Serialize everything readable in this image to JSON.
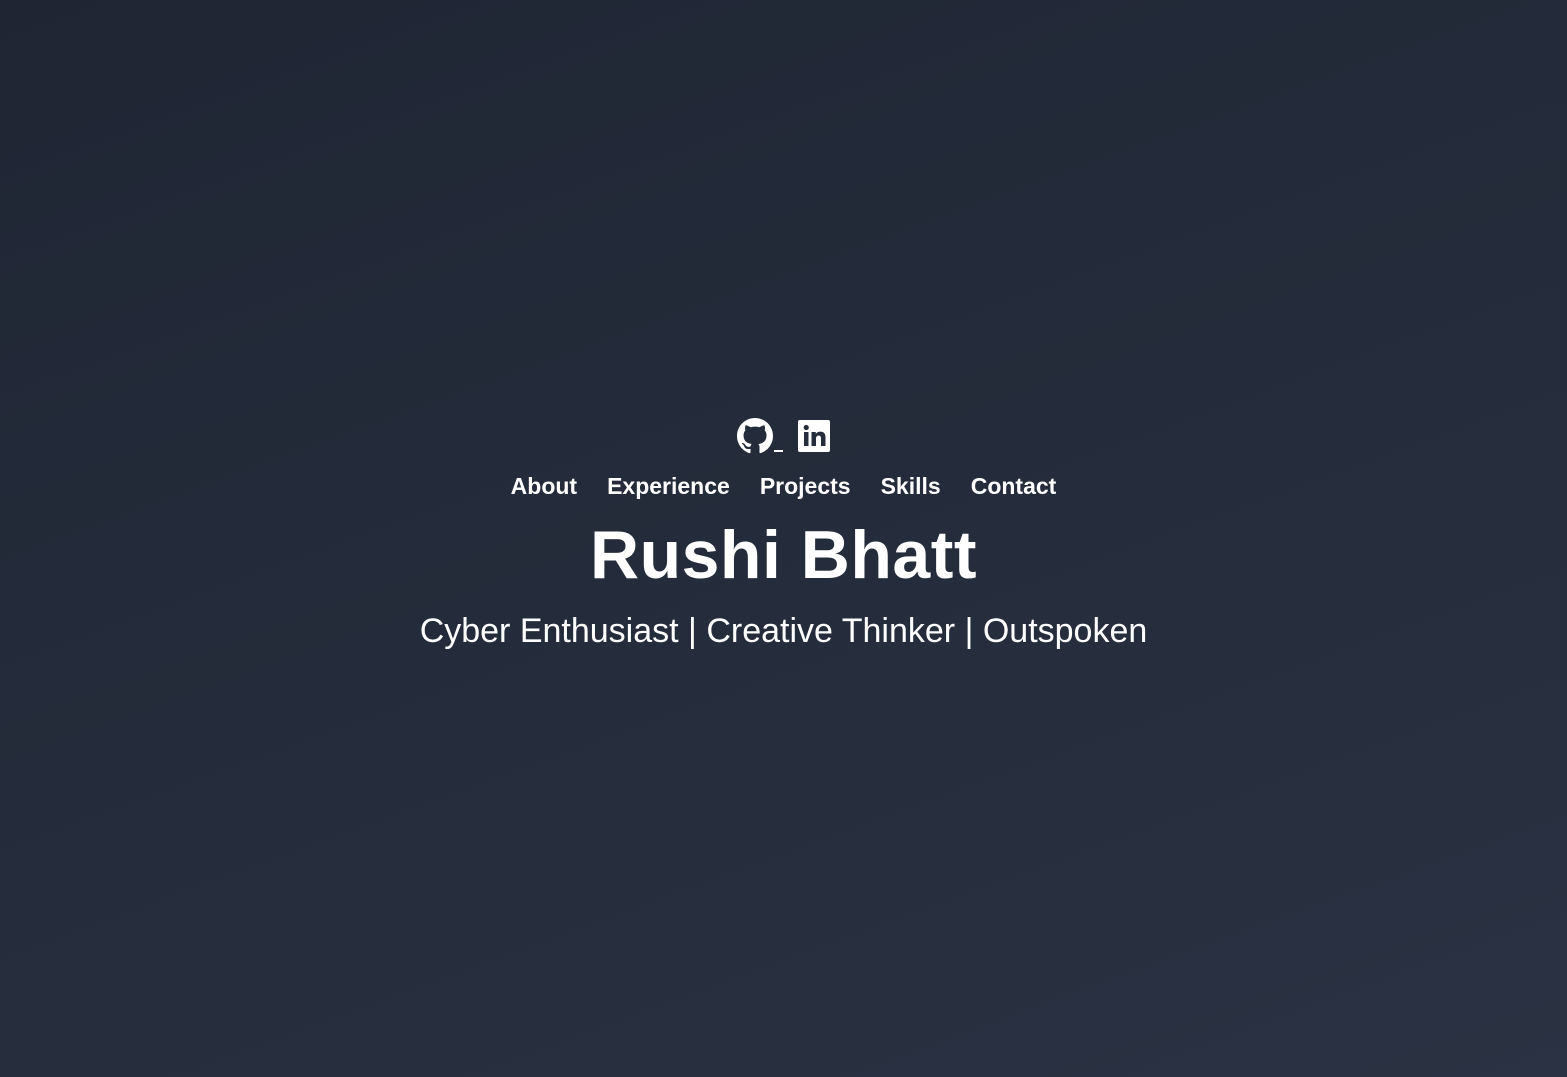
{
  "social": {
    "github_icon": "github-icon",
    "linkedin_icon": "linkedin-icon"
  },
  "nav": {
    "items": [
      {
        "label": "About"
      },
      {
        "label": "Experience"
      },
      {
        "label": "Projects"
      },
      {
        "label": "Skills"
      },
      {
        "label": "Contact"
      }
    ]
  },
  "hero": {
    "name": "Rushi Bhatt",
    "tagline": "Cyber Enthusiast | Creative Thinker | Outspoken"
  },
  "colors": {
    "background_top": "#1f2533",
    "background_bottom": "#2a3243",
    "text": "#ffffff"
  }
}
